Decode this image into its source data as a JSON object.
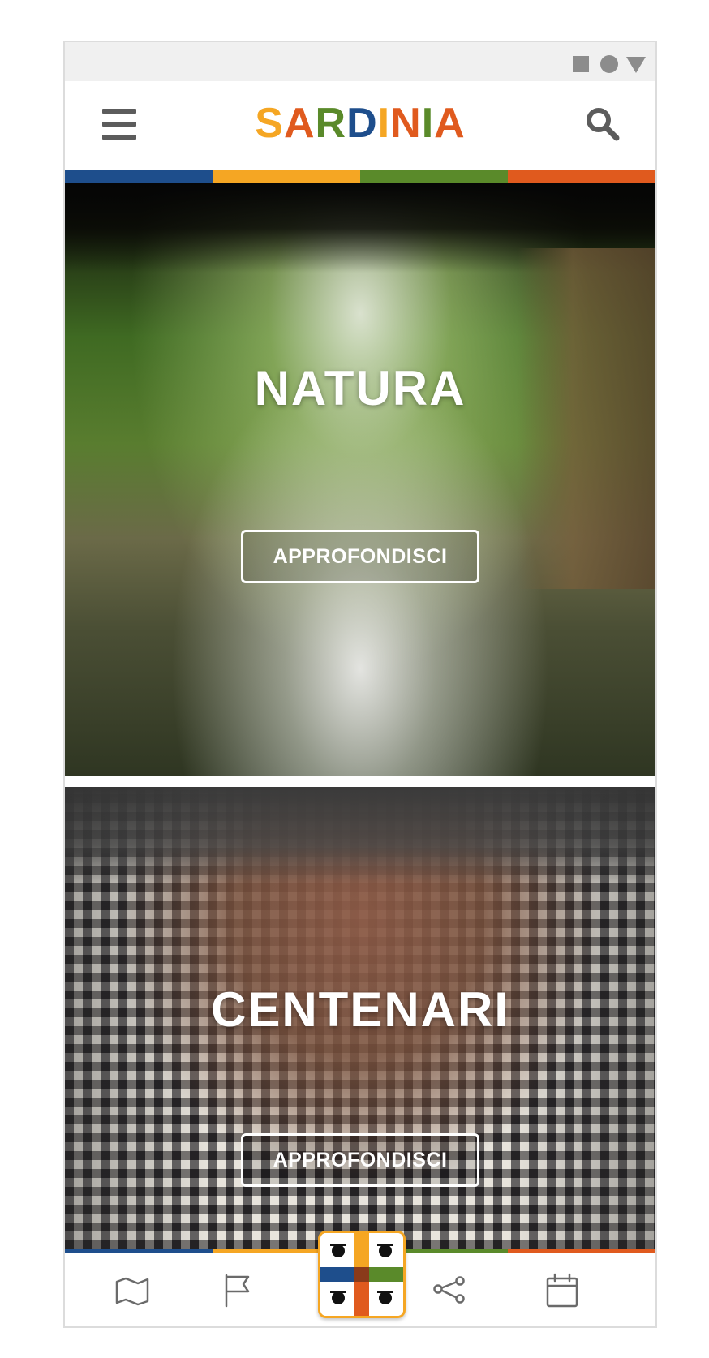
{
  "app": {
    "logo_letters": [
      {
        "char": "S",
        "color": "#f5a623"
      },
      {
        "char": "A",
        "color": "#e05a1e"
      },
      {
        "char": "R",
        "color": "#5a8a2a"
      },
      {
        "char": "D",
        "color": "#1e4e8c"
      },
      {
        "char": "I",
        "color": "#f5a623"
      },
      {
        "char": "N",
        "color": "#e05a1e"
      },
      {
        "char": "I",
        "color": "#5a8a2a"
      },
      {
        "char": "A",
        "color": "#e05a1e"
      }
    ],
    "brand_colors": [
      "#1e4e8c",
      "#f5a623",
      "#5a8a2a",
      "#e05a1e"
    ]
  },
  "status_bar": {
    "icons": [
      "stop-square-icon",
      "home-circle-icon",
      "back-triangle-icon"
    ]
  },
  "header": {
    "menu_icon": "hamburger-menu-icon",
    "search_icon": "search-icon"
  },
  "cards": [
    {
      "title": "NATURA",
      "button_label": "APPROFONDISCI"
    },
    {
      "title": "CENTENARI",
      "button_label": "APPROFONDISCI"
    }
  ],
  "bottom_nav": {
    "items": [
      {
        "icon": "map-icon"
      },
      {
        "icon": "flag-icon"
      },
      {
        "icon": "sardinia-flag-icon"
      },
      {
        "icon": "share-icon"
      },
      {
        "icon": "calendar-icon"
      }
    ]
  }
}
